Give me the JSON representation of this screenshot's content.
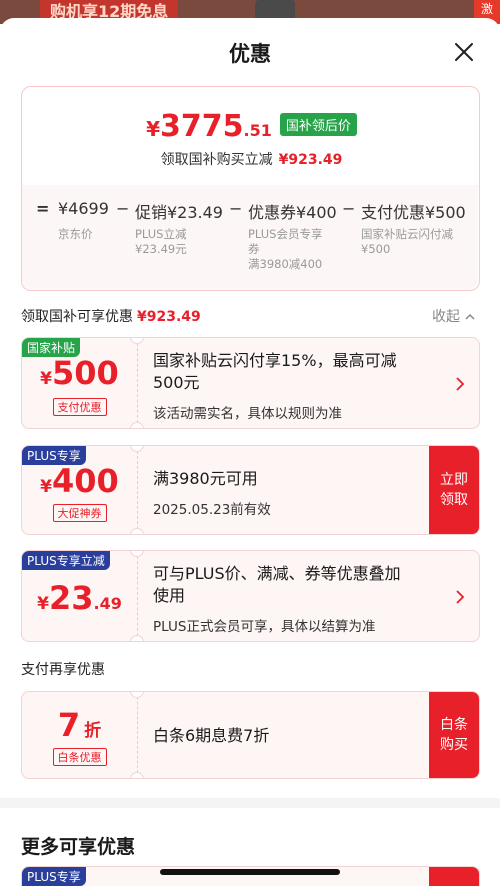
{
  "background": {
    "promo_text": "购机享12期免息",
    "right_text": "激"
  },
  "sheet": {
    "title": "优惠"
  },
  "summary": {
    "price_symbol": "¥",
    "price_int": "3775",
    "price_dec": ".51",
    "price_badge": "国补领后价",
    "sub_label": "领取国补购买立减",
    "sub_amount": "¥923.49",
    "equation": {
      "eq": "=",
      "base": "¥4699",
      "minus1": "−",
      "promo": "促销¥23.49",
      "minus2": "−",
      "coupon": "优惠券¥400",
      "minus3": "−",
      "pay": "支付优惠¥500"
    },
    "notes": {
      "base": "京东价",
      "promo_line1": "PLUS立减",
      "promo_line2": "¥23.49元",
      "coupon_line1": "PLUS会员专享",
      "coupon_line2": "券",
      "coupon_line3": "满3980减400",
      "pay_line1": "国家补贴云闪付减",
      "pay_line2": "¥500"
    }
  },
  "section1": {
    "label": "领取国补可享优惠",
    "amount": "¥923.49",
    "collapse": "收起"
  },
  "coupons": [
    {
      "tag": "国家补贴",
      "sym": "¥",
      "amount": "500",
      "dec": "",
      "subtag": "支付优惠",
      "title_line1": "国家补贴云闪付享15%，最高可减",
      "title_line2": "500元",
      "desc": "该活动需实名，具体以规则为准"
    },
    {
      "tag": "PLUS专享",
      "sym": "¥",
      "amount": "400",
      "dec": "",
      "subtag": "大促神券",
      "title_line1": "满3980元可用",
      "desc": "2025.05.23前有效",
      "claim_line1": "立即",
      "claim_line2": "领取"
    },
    {
      "tag": "PLUS专享立减",
      "sym": "¥",
      "amount": "23",
      "dec": ".49",
      "title_line1": "可与PLUS价、满减、券等优惠叠加",
      "title_line2": "使用",
      "desc": "PLUS正式会员可享，具体以结算为准"
    }
  ],
  "section2": {
    "label": "支付再享优惠"
  },
  "pay_coupon": {
    "amount": "7",
    "unit": "折",
    "subtag": "白条优惠",
    "title": "白条6期息费7折",
    "claim_line1": "白条",
    "claim_line2": "购买"
  },
  "more": {
    "title": "更多可享优惠",
    "tag": "PLUS专享"
  },
  "colors": {
    "accent": "#e8202a",
    "green": "#27a34a",
    "blue": "#2a3f9c"
  }
}
